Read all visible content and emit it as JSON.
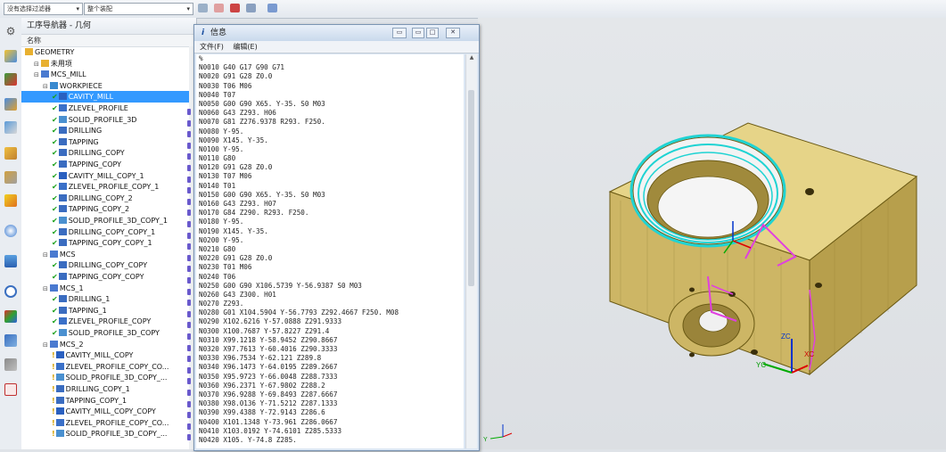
{
  "toolbar": {
    "filter_label": "没有选择过滤器",
    "scope_label": "整个装配",
    "icons": [
      "select-icon",
      "snap-icon",
      "point-icon",
      "axis-icon",
      "view-icon"
    ]
  },
  "navigator": {
    "title": "工序导航器 - 几何",
    "column_header": "名称",
    "rows": [
      {
        "label": "GEOMETRY",
        "indent": 0,
        "status": "",
        "icon": "folder"
      },
      {
        "label": "未用项",
        "indent": 1,
        "status": "",
        "icon": "folder"
      },
      {
        "label": "MCS_MILL",
        "indent": 1,
        "status": "",
        "icon": "mcs"
      },
      {
        "label": "WORKPIECE",
        "indent": 2,
        "status": "",
        "icon": "workpiece"
      },
      {
        "label": "CAVITY_MILL",
        "indent": 3,
        "status": "check",
        "icon": "cavity",
        "selected": true
      },
      {
        "label": "ZLEVEL_PROFILE",
        "indent": 3,
        "status": "check",
        "icon": "zlevel"
      },
      {
        "label": "SOLID_PROFILE_3D",
        "indent": 3,
        "status": "check",
        "icon": "solid"
      },
      {
        "label": "DRILLING",
        "indent": 3,
        "status": "check",
        "icon": "drill"
      },
      {
        "label": "TAPPING",
        "indent": 3,
        "status": "check",
        "icon": "drill"
      },
      {
        "label": "DRILLING_COPY",
        "indent": 3,
        "status": "check",
        "icon": "drill"
      },
      {
        "label": "TAPPING_COPY",
        "indent": 3,
        "status": "check",
        "icon": "drill"
      },
      {
        "label": "CAVITY_MILL_COPY_1",
        "indent": 3,
        "status": "check",
        "icon": "cavity"
      },
      {
        "label": "ZLEVEL_PROFILE_COPY_1",
        "indent": 3,
        "status": "check",
        "icon": "zlevel"
      },
      {
        "label": "DRILLING_COPY_2",
        "indent": 3,
        "status": "check",
        "icon": "drill"
      },
      {
        "label": "TAPPING_COPY_2",
        "indent": 3,
        "status": "check",
        "icon": "drill"
      },
      {
        "label": "SOLID_PROFILE_3D_COPY_1",
        "indent": 3,
        "status": "check",
        "icon": "solid"
      },
      {
        "label": "DRILLING_COPY_COPY_1",
        "indent": 3,
        "status": "check",
        "icon": "drill"
      },
      {
        "label": "TAPPING_COPY_COPY_1",
        "indent": 3,
        "status": "check",
        "icon": "drill"
      },
      {
        "label": "MCS",
        "indent": 2,
        "status": "",
        "icon": "mcs"
      },
      {
        "label": "DRILLING_COPY_COPY",
        "indent": 3,
        "status": "check",
        "icon": "drill"
      },
      {
        "label": "TAPPING_COPY_COPY",
        "indent": 3,
        "status": "check",
        "icon": "drill"
      },
      {
        "label": "MCS_1",
        "indent": 2,
        "status": "",
        "icon": "mcs"
      },
      {
        "label": "DRILLING_1",
        "indent": 3,
        "status": "check",
        "icon": "drill"
      },
      {
        "label": "TAPPING_1",
        "indent": 3,
        "status": "check",
        "icon": "drill"
      },
      {
        "label": "ZLEVEL_PROFILE_COPY",
        "indent": 3,
        "status": "check",
        "icon": "zlevel"
      },
      {
        "label": "SOLID_PROFILE_3D_COPY",
        "indent": 3,
        "status": "check",
        "icon": "solid"
      },
      {
        "label": "MCS_2",
        "indent": 2,
        "status": "",
        "icon": "mcs"
      },
      {
        "label": "CAVITY_MILL_COPY",
        "indent": 3,
        "status": "warn",
        "icon": "cavity"
      },
      {
        "label": "ZLEVEL_PROFILE_COPY_CO...",
        "indent": 3,
        "status": "warn",
        "icon": "zlevel"
      },
      {
        "label": "SOLID_PROFILE_3D_COPY_...",
        "indent": 3,
        "status": "warn",
        "icon": "solid"
      },
      {
        "label": "DRILLING_COPY_1",
        "indent": 3,
        "status": "warn",
        "icon": "drill"
      },
      {
        "label": "TAPPING_COPY_1",
        "indent": 3,
        "status": "warn",
        "icon": "drill"
      },
      {
        "label": "CAVITY_MILL_COPY_COPY",
        "indent": 3,
        "status": "warn",
        "icon": "cavity"
      },
      {
        "label": "ZLEVEL_PROFILE_COPY_CO...",
        "indent": 3,
        "status": "warn",
        "icon": "zlevel"
      },
      {
        "label": "SOLID_PROFILE_3D_COPY_...",
        "indent": 3,
        "status": "warn",
        "icon": "solid"
      }
    ]
  },
  "info_window": {
    "title": "信息",
    "menu": [
      "文件(F)",
      "编辑(E)"
    ],
    "lines": [
      "%",
      "N0010 G40 G17 G90 G71",
      "N0020 G91 G28 Z0.0",
      "N0030 T06 M06",
      "N0040 T07",
      "N0050 G00 G90 X65. Y-35. S0 M03",
      "N0060 G43 Z293. H06",
      "N0070 G81 Z276.9378 R293. F250.",
      "N0080 Y-95.",
      "N0090 X145. Y-35.",
      "N0100 Y-95.",
      "N0110 G80",
      "N0120 G91 G28 Z0.0",
      "N0130 T07 M06",
      "N0140 T01",
      "N0150 G00 G90 X65. Y-35. S0 M03",
      "N0160 G43 Z293. H07",
      "N0170 G84 Z290. R293. F250.",
      "N0180 Y-95.",
      "N0190 X145. Y-35.",
      "N0200 Y-95.",
      "N0210 G80",
      "N0220 G91 G28 Z0.0",
      "N0230 T01 M06",
      "N0240 T06",
      "N0250 G00 G90 X106.5739 Y-56.9387 S0 M03",
      "N0260 G43 Z300. H01",
      "N0270 Z293.",
      "N0280 G01 X104.5904 Y-56.7793 Z292.4667 F250. M08",
      "N0290 X102.6216 Y-57.0888 Z291.9333",
      "N0300 X100.7687 Y-57.8227 Z291.4",
      "N0310 X99.1218 Y-58.9452 Z290.8667",
      "N0320 X97.7613 Y-60.4016 Z290.3333",
      "N0330 X96.7534 Y-62.121 Z289.8",
      "N0340 X96.1473 Y-64.0195 Z289.2667",
      "N0350 X95.9723 Y-66.0048 Z288.7333",
      "N0360 X96.2371 Y-67.9802 Z288.2",
      "N0370 X96.9288 Y-69.8493 Z287.6667",
      "N0380 X98.0136 Y-71.5212 Z287.1333",
      "N0390 X99.4388 Y-72.9143 Z286.6",
      "N0400 X101.1348 Y-73.961 Z286.0667",
      "N0410 X103.0192 Y-74.6101 Z285.5333",
      "N0420 X105. Y-74.8 Z285."
    ]
  },
  "viewport": {
    "axis_labels": {
      "x": "XC",
      "y": "YC",
      "z": "ZC"
    },
    "triad_labels": {
      "x": "X",
      "y": "Y"
    },
    "colors": {
      "part": "#dcc97a",
      "toolpath": "#1fd3d3",
      "marker": "#e040e0",
      "edge": "#5a4a10"
    }
  }
}
